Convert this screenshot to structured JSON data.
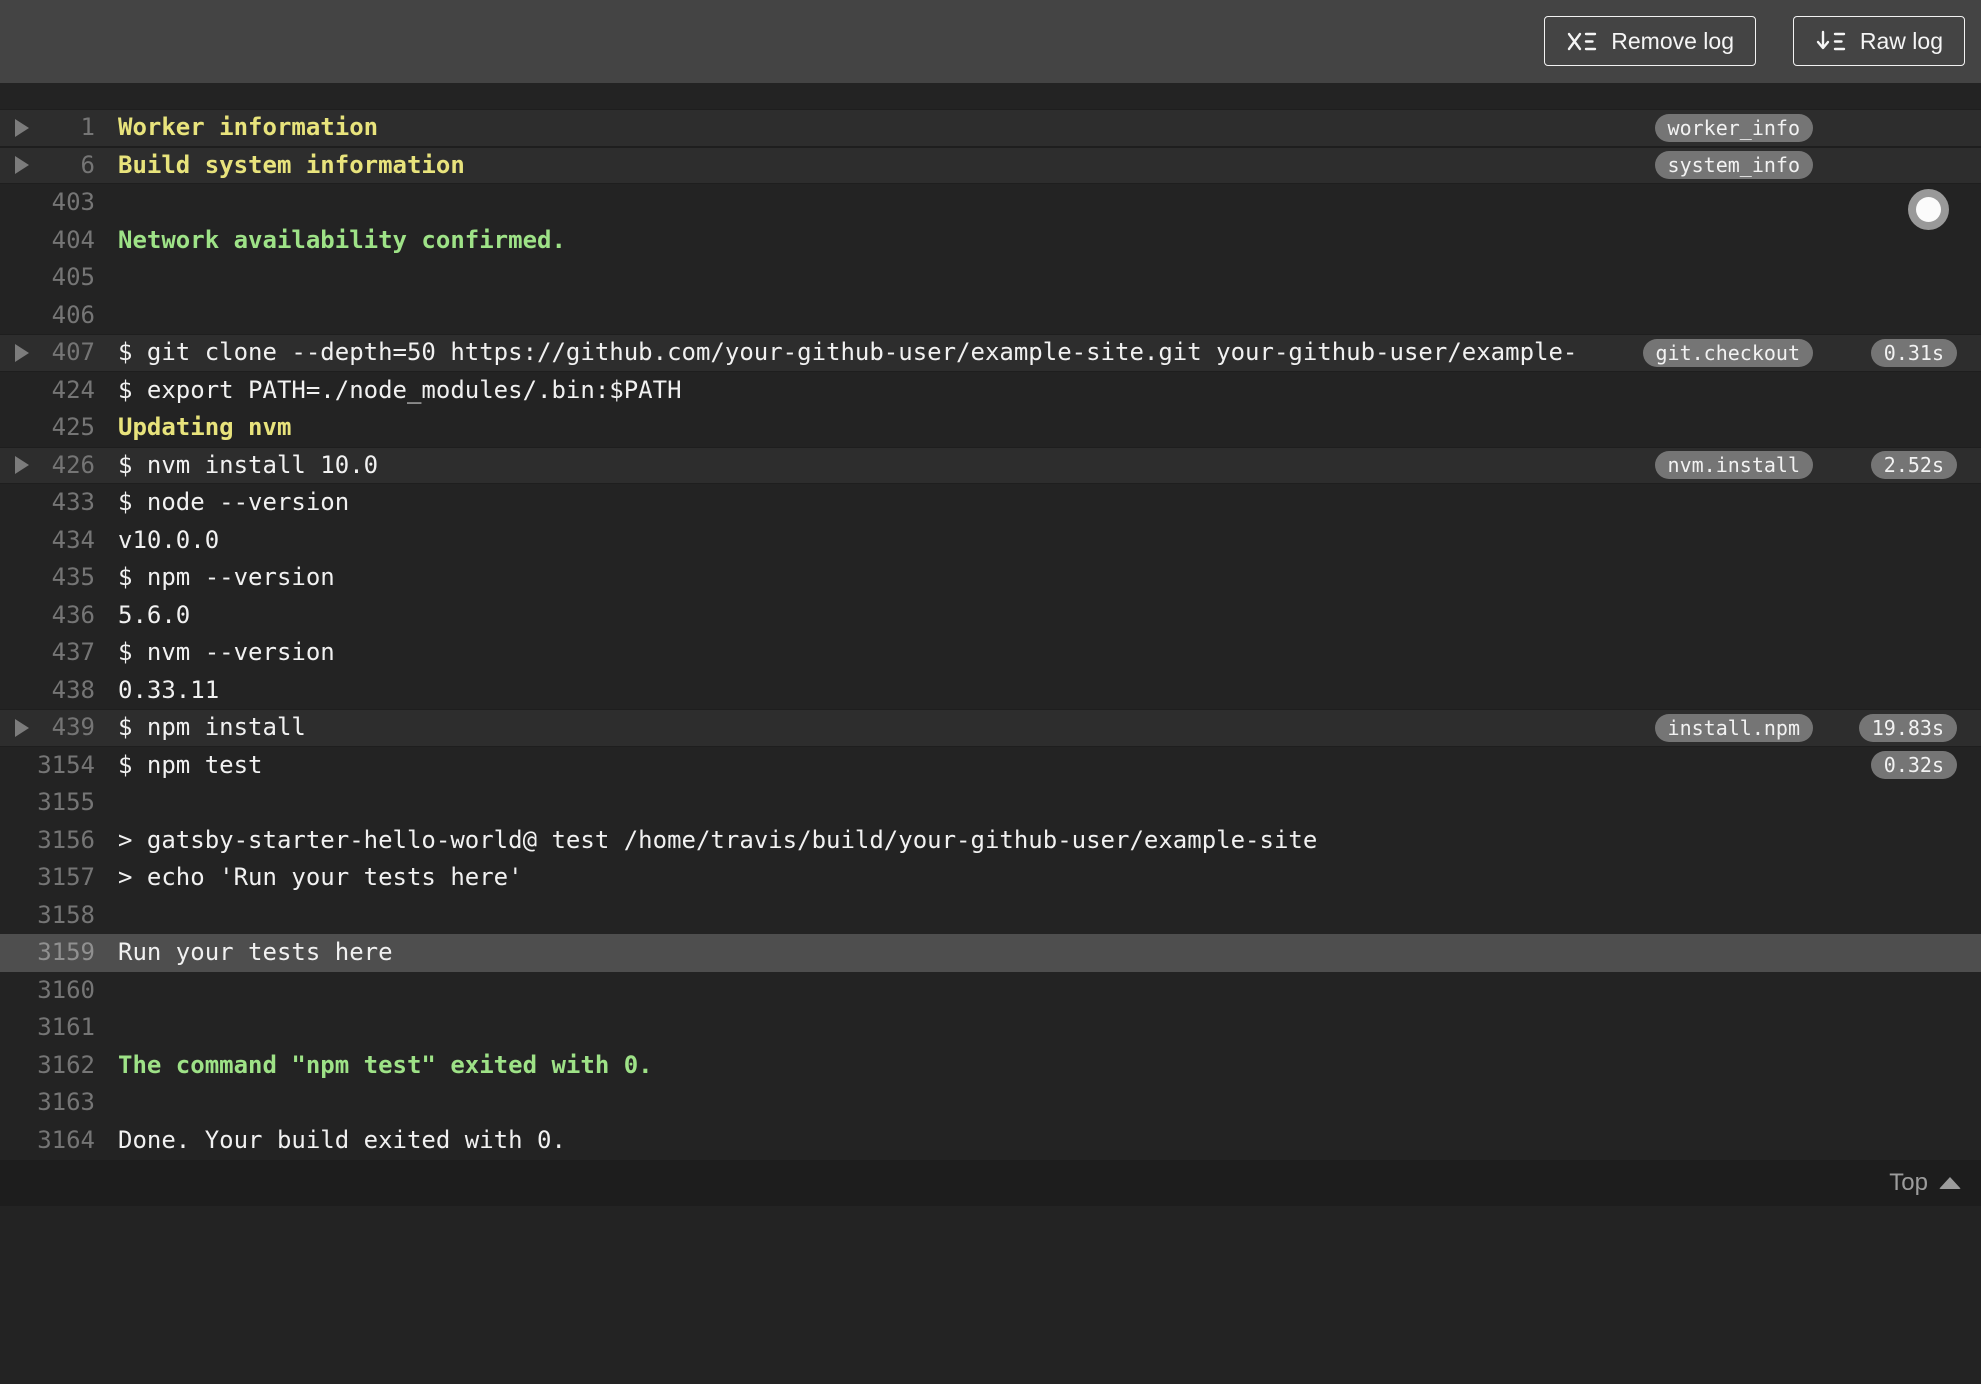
{
  "toolbar": {
    "remove_log_label": "Remove log",
    "raw_log_label": "Raw log"
  },
  "colors": {
    "topbar_bg": "#444444",
    "log_bg": "#232323",
    "fold_row_bg": "#2d2d2d",
    "highlight_row_bg": "#4e4e4e",
    "text_default": "#f1f1f1",
    "text_yellow": "#e8e37c",
    "text_green": "#9ee287",
    "line_number": "#757575",
    "pill_bg": "#757575"
  },
  "footer": {
    "top_label": "Top"
  },
  "log": {
    "rows": [
      {
        "num": "1",
        "text": "Worker information",
        "color": "yellow",
        "fold": true,
        "tag": "worker_info"
      },
      {
        "num": "6",
        "text": "Build system information",
        "color": "yellow",
        "fold": true,
        "tag": "system_info"
      },
      {
        "num": "403",
        "text": ""
      },
      {
        "num": "404",
        "text": "Network availability confirmed.",
        "color": "green"
      },
      {
        "num": "405",
        "text": ""
      },
      {
        "num": "406",
        "text": ""
      },
      {
        "num": "407",
        "text": "$ git clone --depth=50 https://github.com/your-github-user/example-site.git your-github-user/example-",
        "fold": true,
        "tag": "git.checkout",
        "duration": "0.31s"
      },
      {
        "num": "424",
        "text": "$ export PATH=./node_modules/.bin:$PATH"
      },
      {
        "num": "425",
        "text": "Updating nvm",
        "color": "yellow"
      },
      {
        "num": "426",
        "text": "$ nvm install 10.0",
        "fold": true,
        "tag": "nvm.install",
        "duration": "2.52s"
      },
      {
        "num": "433",
        "text": "$ node --version"
      },
      {
        "num": "434",
        "text": "v10.0.0"
      },
      {
        "num": "435",
        "text": "$ npm --version"
      },
      {
        "num": "436",
        "text": "5.6.0"
      },
      {
        "num": "437",
        "text": "$ nvm --version"
      },
      {
        "num": "438",
        "text": "0.33.11"
      },
      {
        "num": "439",
        "text": "$ npm install",
        "fold": true,
        "tag": "install.npm",
        "duration": "19.83s"
      },
      {
        "num": "3154",
        "text": "$ npm test",
        "duration": "0.32s"
      },
      {
        "num": "3155",
        "text": ""
      },
      {
        "num": "3156",
        "text": "> gatsby-starter-hello-world@ test /home/travis/build/your-github-user/example-site"
      },
      {
        "num": "3157",
        "text": "> echo 'Run your tests here'"
      },
      {
        "num": "3158",
        "text": ""
      },
      {
        "num": "3159",
        "text": "Run your tests here",
        "highlight": true
      },
      {
        "num": "3160",
        "text": ""
      },
      {
        "num": "3161",
        "text": ""
      },
      {
        "num": "3162",
        "text": "The command \"npm test\" exited with 0.",
        "color": "green"
      },
      {
        "num": "3163",
        "text": ""
      },
      {
        "num": "3164",
        "text": "Done. Your build exited with 0."
      }
    ]
  }
}
